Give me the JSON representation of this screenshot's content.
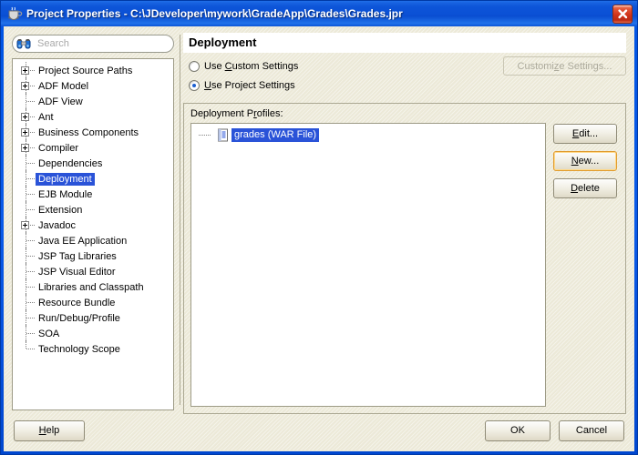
{
  "window": {
    "title": "Project Properties - C:\\JDeveloper\\mywork\\GradeApp\\Grades\\Grades.jpr",
    "icon": "java-coffee-cup-icon",
    "close_label": "Close"
  },
  "search": {
    "placeholder": "Search",
    "value": "",
    "icon": "binoculars-icon"
  },
  "tree": {
    "items": [
      {
        "label": "Project Source Paths",
        "expandable": true,
        "selected": false
      },
      {
        "label": "ADF Model",
        "expandable": true,
        "selected": false
      },
      {
        "label": "ADF View",
        "expandable": false,
        "selected": false
      },
      {
        "label": "Ant",
        "expandable": true,
        "selected": false
      },
      {
        "label": "Business Components",
        "expandable": true,
        "selected": false
      },
      {
        "label": "Compiler",
        "expandable": true,
        "selected": false
      },
      {
        "label": "Dependencies",
        "expandable": false,
        "selected": false
      },
      {
        "label": "Deployment",
        "expandable": false,
        "selected": true
      },
      {
        "label": "EJB Module",
        "expandable": false,
        "selected": false
      },
      {
        "label": "Extension",
        "expandable": false,
        "selected": false
      },
      {
        "label": "Javadoc",
        "expandable": true,
        "selected": false
      },
      {
        "label": "Java EE Application",
        "expandable": false,
        "selected": false
      },
      {
        "label": "JSP Tag Libraries",
        "expandable": false,
        "selected": false
      },
      {
        "label": "JSP Visual Editor",
        "expandable": false,
        "selected": false
      },
      {
        "label": "Libraries and Classpath",
        "expandable": false,
        "selected": false
      },
      {
        "label": "Resource Bundle",
        "expandable": false,
        "selected": false
      },
      {
        "label": "Run/Debug/Profile",
        "expandable": false,
        "selected": false
      },
      {
        "label": "SOA",
        "expandable": false,
        "selected": false
      },
      {
        "label": "Technology Scope",
        "expandable": false,
        "selected": false
      }
    ]
  },
  "panel": {
    "title": "Deployment",
    "radios": [
      {
        "label_pre": "Use ",
        "mnemonic": "C",
        "label_post": "ustom Settings",
        "checked": false
      },
      {
        "label_pre": "",
        "mnemonic": "U",
        "label_post": "se Project Settings",
        "checked": true
      }
    ],
    "customize_button": {
      "pre": "Customi",
      "mnemonic": "z",
      "post": "e Settings...",
      "disabled": true
    },
    "group_label_pre": "Deployment P",
    "group_label_mnemonic": "r",
    "group_label_post": "ofiles:",
    "profiles": [
      {
        "label": "grades (WAR File)",
        "icon": "document-icon",
        "selected": true
      }
    ],
    "side_buttons": [
      {
        "pre": "",
        "mnemonic": "E",
        "post": "dit...",
        "focused": false
      },
      {
        "pre": "",
        "mnemonic": "N",
        "post": "ew...",
        "focused": true
      },
      {
        "pre": "",
        "mnemonic": "D",
        "post": "elete",
        "focused": false
      }
    ]
  },
  "footer": {
    "help": {
      "pre": "",
      "mnemonic": "H",
      "post": "elp"
    },
    "ok": "OK",
    "cancel": "Cancel"
  },
  "colors": {
    "titlebar_blue": "#0a51d6",
    "selection_blue": "#2a53d8",
    "focus_amber": "#e09b2e",
    "face": "#ece9d8",
    "close_red": "#d0331a"
  }
}
